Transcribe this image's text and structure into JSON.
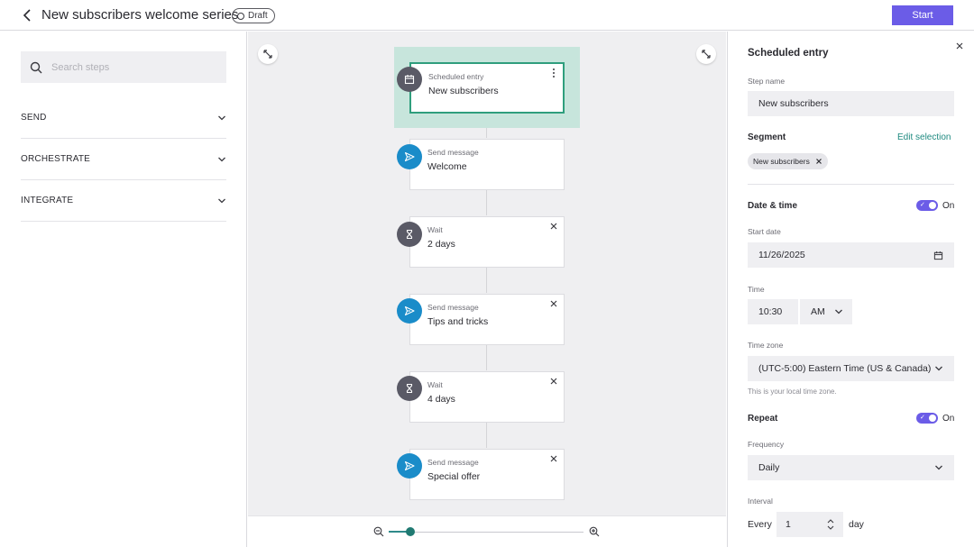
{
  "header": {
    "title": "New subscribers welcome series",
    "status": "Draft",
    "start_label": "Start",
    "accent_color": "#6b5ce7"
  },
  "left_panel": {
    "search_placeholder": "Search steps",
    "categories": [
      "SEND",
      "ORCHESTRATE",
      "INTEGRATE"
    ]
  },
  "canvas": {
    "nodes": [
      {
        "kind": "Scheduled entry",
        "name": "New subscribers",
        "icon": "calendar-icon",
        "selected": true
      },
      {
        "kind": "Send message",
        "name": "Welcome",
        "icon": "send-icon"
      },
      {
        "kind": "Wait",
        "name": "2 days",
        "icon": "hourglass-icon"
      },
      {
        "kind": "Send message",
        "name": "Tips and tricks",
        "icon": "send-icon"
      },
      {
        "kind": "Wait",
        "name": "4 days",
        "icon": "hourglass-icon"
      },
      {
        "kind": "Send message",
        "name": "Special offer",
        "icon": "send-icon"
      }
    ],
    "zoom_level": 0.11
  },
  "right_panel": {
    "title": "Scheduled entry",
    "step_name_label": "Step name",
    "step_name_value": "New subscribers",
    "segment_label": "Segment",
    "edit_selection": "Edit selection",
    "segment_chip": "New subscribers",
    "date_time_label": "Date & time",
    "date_time_on": "On",
    "start_date_label": "Start date",
    "start_date_value": "11/26/2025",
    "time_label": "Time",
    "time_value": "10:30",
    "ampm_value": "AM",
    "time_zone_label": "Time zone",
    "time_zone_value": "(UTC-5:00) Eastern Time (US & Canada)",
    "time_zone_hint": "This is your local time zone.",
    "repeat_label": "Repeat",
    "repeat_on": "On",
    "frequency_label": "Frequency",
    "frequency_value": "Daily",
    "interval_label": "Interval",
    "every_label": "Every",
    "interval_value": "1",
    "interval_unit": "day"
  }
}
